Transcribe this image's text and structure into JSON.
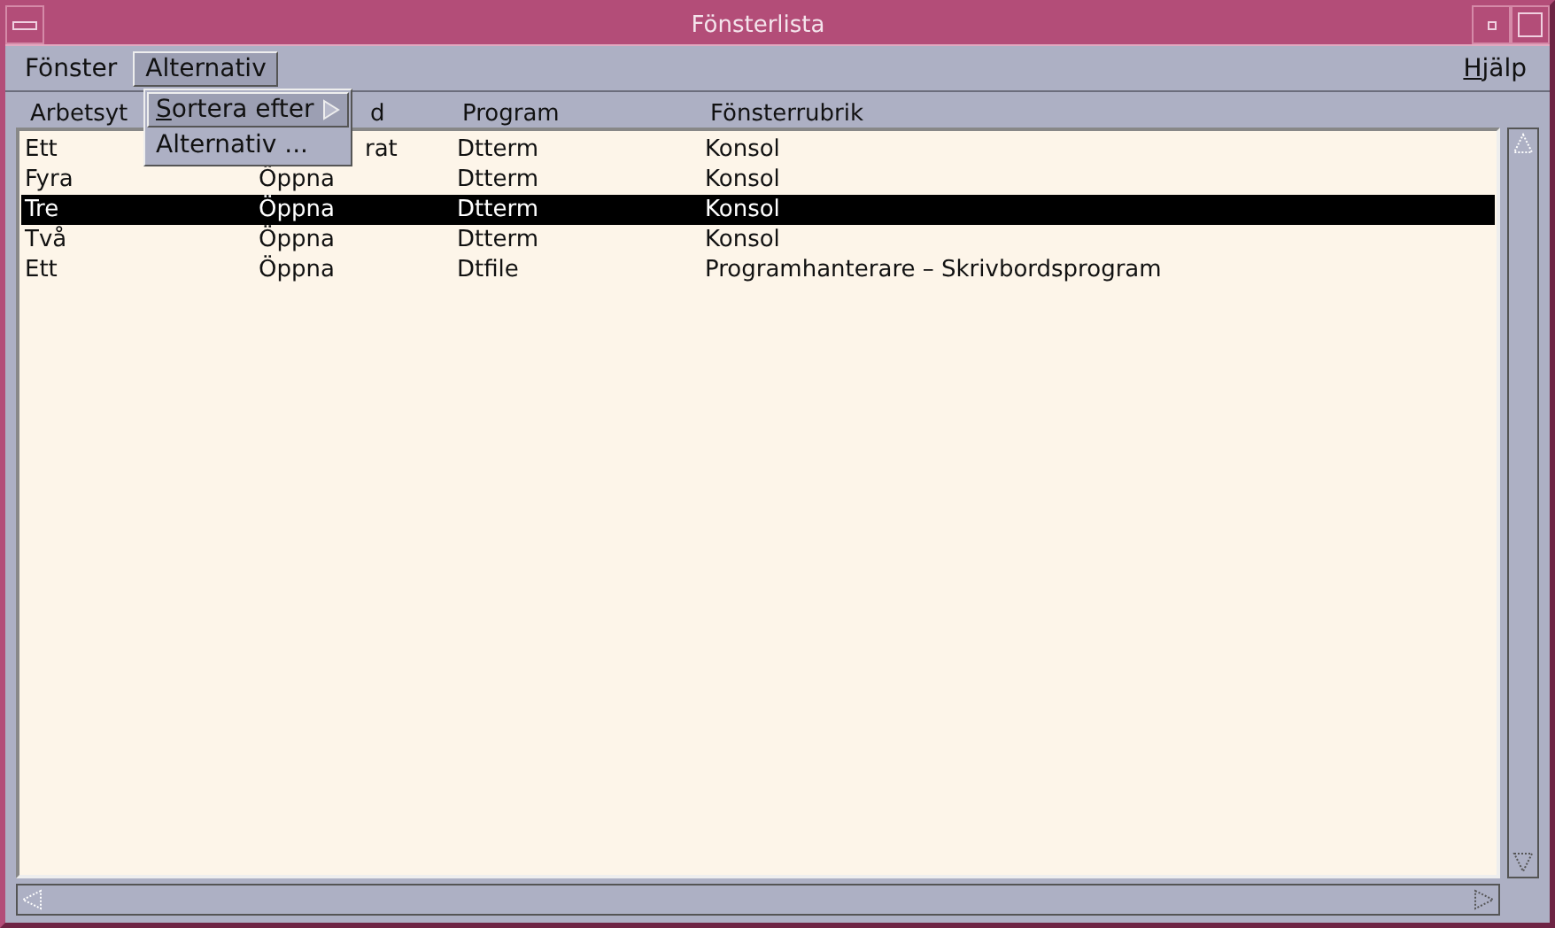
{
  "window": {
    "title": "Fönsterlista"
  },
  "menubar": {
    "items": [
      {
        "label": "Fönster",
        "selected": false
      },
      {
        "label": "Alternativ",
        "selected": true
      }
    ],
    "help": {
      "label": "Hjälp",
      "mnemonic": true
    }
  },
  "menu": {
    "items": [
      {
        "label": "Sortera efter",
        "mnemonic": true,
        "submenu": true,
        "selected": true
      },
      {
        "label": "Alternativ ...",
        "mnemonic": false,
        "submenu": false,
        "selected": false
      }
    ]
  },
  "table": {
    "columns": [
      {
        "label": "Arbetsyt"
      },
      {
        "label": "d",
        "covered": true
      },
      {
        "label": "Program"
      },
      {
        "label": "Fönsterrubrik"
      }
    ],
    "rows": [
      {
        "cells": [
          {
            "text": "Ett"
          },
          {
            "text": "rat",
            "covered": true
          },
          {
            "text": "Dtterm"
          },
          {
            "text": "Konsol"
          }
        ],
        "selected": false
      },
      {
        "cells": [
          {
            "text": "Fyra"
          },
          {
            "text": "Öppna"
          },
          {
            "text": "Dtterm"
          },
          {
            "text": "Konsol"
          }
        ],
        "selected": false
      },
      {
        "cells": [
          {
            "text": "Tre"
          },
          {
            "text": "Öppna"
          },
          {
            "text": "Dtterm"
          },
          {
            "text": "Konsol"
          }
        ],
        "selected": true
      },
      {
        "cells": [
          {
            "text": "Två"
          },
          {
            "text": "Öppna"
          },
          {
            "text": "Dtterm"
          },
          {
            "text": "Konsol"
          }
        ],
        "selected": false
      },
      {
        "cells": [
          {
            "text": "Ett"
          },
          {
            "text": "Öppna"
          },
          {
            "text": "Dtfile"
          },
          {
            "text": "Programhanterare – Skrivbordsprogram"
          }
        ],
        "selected": false
      }
    ]
  }
}
